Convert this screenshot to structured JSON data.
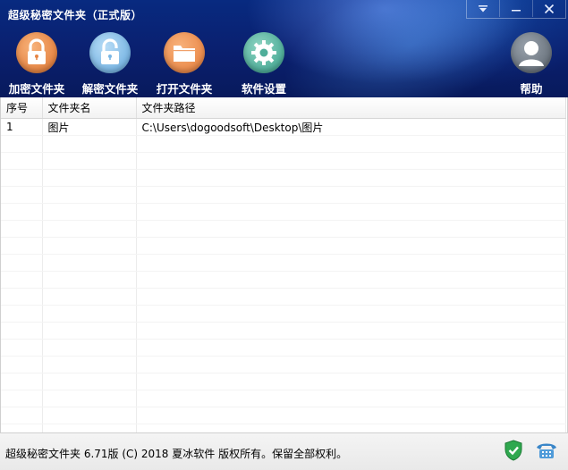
{
  "window": {
    "title": "超级秘密文件夹（正式版）",
    "controls": [
      "menu",
      "minimize",
      "close"
    ]
  },
  "toolbar": {
    "encrypt_label": "加密文件夹",
    "decrypt_label": "解密文件夹",
    "open_label": "打开文件夹",
    "settings_label": "软件设置",
    "help_label": "帮助"
  },
  "table": {
    "headers": [
      "序号",
      "文件夹名",
      "文件夹路径"
    ],
    "rows": [
      [
        "1",
        "图片",
        "C:\\Users\\dogoodsoft\\Desktop\\图片"
      ]
    ],
    "empty_row_count": 18
  },
  "status": {
    "text": "超级秘密文件夹 6.71版 (C) 2018 夏冰软件 版权所有。保留全部权利。"
  },
  "colors": {
    "header_bg": "#0a1f6e",
    "encrypt": "#e68544",
    "decrypt": "#7ab6e4",
    "settings": "#4fae9a",
    "shield": "#2fa84f"
  }
}
